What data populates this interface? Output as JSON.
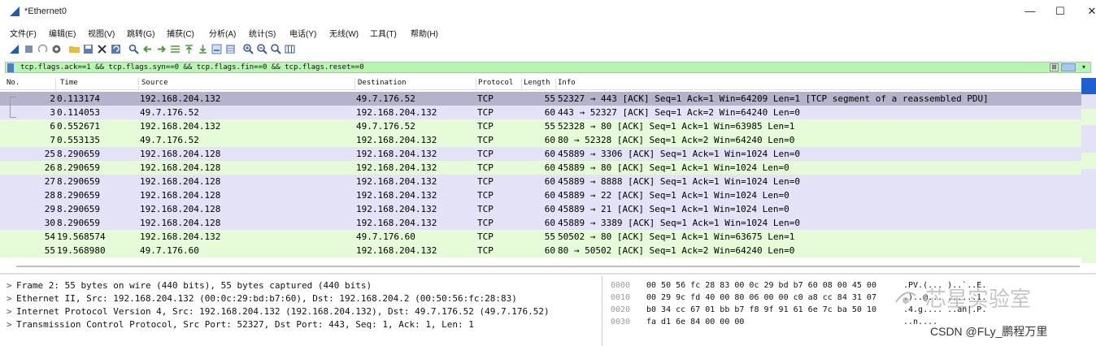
{
  "window": {
    "title": "*Ethernet0",
    "minimize": "—",
    "maximize": "☐",
    "close": "✕"
  },
  "menu": [
    "文件(F)",
    "编辑(E)",
    "视图(V)",
    "跳转(G)",
    "捕获(C)",
    "分析(A)",
    "统计(S)",
    "电话(Y)",
    "无线(W)",
    "工具(T)",
    "帮助(H)"
  ],
  "toolbar_icons": [
    "shark-fin-start-icon",
    "stop-icon",
    "restart-icon",
    "options-icon",
    "open-folder-icon",
    "save-icon",
    "close-file-icon",
    "reload-icon",
    "find-icon",
    "back-icon",
    "forward-icon",
    "goto-icon",
    "first-packet-icon",
    "last-packet-icon",
    "autoscroll-icon",
    "colorize-icon",
    "zoom-in-icon",
    "zoom-out-icon",
    "zoom-reset-icon",
    "resize-columns-icon"
  ],
  "filter": {
    "text": "tcp.flags.ack==1 && tcp.flags.syn==0 && tcp.flags.fin==0 && tcp.flags.reset==0",
    "clear": "⊠",
    "dropdown": "▾"
  },
  "columns": {
    "no": "No.",
    "time": "Time",
    "source": "Source",
    "destination": "Destination",
    "protocol": "Protocol",
    "length": "Length",
    "info": "Info"
  },
  "packets": [
    {
      "no": "2",
      "time": "0.113174",
      "src": "192.168.204.132",
      "dst": "49.7.176.52",
      "proto": "TCP",
      "len": "55",
      "info": "52327 → 443 [ACK] Seq=1 Ack=1 Win=64209 Len=1 [TCP segment of a reassembled PDU]",
      "style": "sel"
    },
    {
      "no": "3",
      "time": "0.114053",
      "src": "49.7.176.52",
      "dst": "192.168.204.132",
      "proto": "TCP",
      "len": "60",
      "info": "443 → 52327 [ACK] Seq=1 Ack=2 Win=64240 Len=0",
      "style": "lav"
    },
    {
      "no": "6",
      "time": "0.552671",
      "src": "192.168.204.132",
      "dst": "49.7.176.52",
      "proto": "TCP",
      "len": "55",
      "info": "52328 → 80 [ACK] Seq=1 Ack=1 Win=63985 Len=1",
      "style": "green"
    },
    {
      "no": "7",
      "time": "0.553135",
      "src": "49.7.176.52",
      "dst": "192.168.204.132",
      "proto": "TCP",
      "len": "60",
      "info": "80 → 52328 [ACK] Seq=1 Ack=2 Win=64240 Len=0",
      "style": "green"
    },
    {
      "no": "25",
      "time": "8.290659",
      "src": "192.168.204.128",
      "dst": "192.168.204.132",
      "proto": "TCP",
      "len": "60",
      "info": "45889 → 3306 [ACK] Seq=1 Ack=1 Win=1024 Len=0",
      "style": "lav"
    },
    {
      "no": "26",
      "time": "8.290659",
      "src": "192.168.204.128",
      "dst": "192.168.204.132",
      "proto": "TCP",
      "len": "60",
      "info": "45889 → 80 [ACK] Seq=1 Ack=1 Win=1024 Len=0",
      "style": "green"
    },
    {
      "no": "27",
      "time": "8.290659",
      "src": "192.168.204.128",
      "dst": "192.168.204.132",
      "proto": "TCP",
      "len": "60",
      "info": "45889 → 8888 [ACK] Seq=1 Ack=1 Win=1024 Len=0",
      "style": "lav"
    },
    {
      "no": "28",
      "time": "8.290659",
      "src": "192.168.204.128",
      "dst": "192.168.204.132",
      "proto": "TCP",
      "len": "60",
      "info": "45889 → 22 [ACK] Seq=1 Ack=1 Win=1024 Len=0",
      "style": "lav"
    },
    {
      "no": "29",
      "time": "8.290659",
      "src": "192.168.204.128",
      "dst": "192.168.204.132",
      "proto": "TCP",
      "len": "60",
      "info": "45889 → 21 [ACK] Seq=1 Ack=1 Win=1024 Len=0",
      "style": "lav"
    },
    {
      "no": "30",
      "time": "8.290659",
      "src": "192.168.204.128",
      "dst": "192.168.204.132",
      "proto": "TCP",
      "len": "60",
      "info": "45889 → 3389 [ACK] Seq=1 Ack=1 Win=1024 Len=0",
      "style": "lav"
    },
    {
      "no": "54",
      "time": "19.568574",
      "src": "192.168.204.132",
      "dst": "49.7.176.60",
      "proto": "TCP",
      "len": "55",
      "info": "50502 → 80 [ACK] Seq=1 Ack=1 Win=63675 Len=1",
      "style": "green"
    },
    {
      "no": "55",
      "time": "19.568980",
      "src": "49.7.176.60",
      "dst": "192.168.204.132",
      "proto": "TCP",
      "len": "60",
      "info": "80 → 50502 [ACK] Seq=1 Ack=2 Win=64240 Len=0",
      "style": "green"
    }
  ],
  "details": [
    "Frame 2: 55 bytes on wire (440 bits), 55 bytes captured (440 bits)",
    "Ethernet II, Src: 192.168.204.132 (00:0c:29:bd:b7:60), Dst: 192.168.204.2 (00:50:56:fc:28:83)",
    "Internet Protocol Version 4, Src: 192.168.204.132 (192.168.204.132), Dst: 49.7.176.52 (49.7.176.52)",
    "Transmission Control Protocol, Src Port: 52327, Dst Port: 443, Seq: 1, Ack: 1, Len: 1"
  ],
  "details_arrow": ">",
  "bytes": [
    {
      "offset": "0000",
      "hex": "00 50 56 fc 28 83 00 0c  29 bd b7 60 08 00 45 00",
      "ascii": ".PV.(... )..`..E."
    },
    {
      "offset": "0010",
      "hex": "00 29 9c fd 40 00 80 06  00 00 c0 a8 cc 84 31 07",
      "ascii": ".)..@... ......1."
    },
    {
      "offset": "0020",
      "hex": "b0 34 cc 67 01 bb b7 f8  9f 91 61 6e 7c ba 50 10",
      "ascii": ".4.g.... ..an|.P."
    },
    {
      "offset": "0030",
      "hex": "fa d1 6e 84 00 00 00",
      "ascii": "..n...."
    }
  ],
  "watermark": {
    "text": "芯星实验室",
    "csdn": "CSDN @FLy_鹏程万里"
  },
  "colors": {
    "filter_bg": "#b7f6b0",
    "row_green": "#e5fbd8",
    "row_lavender": "#e3e2f7",
    "row_selected": "#b4b3cc"
  }
}
